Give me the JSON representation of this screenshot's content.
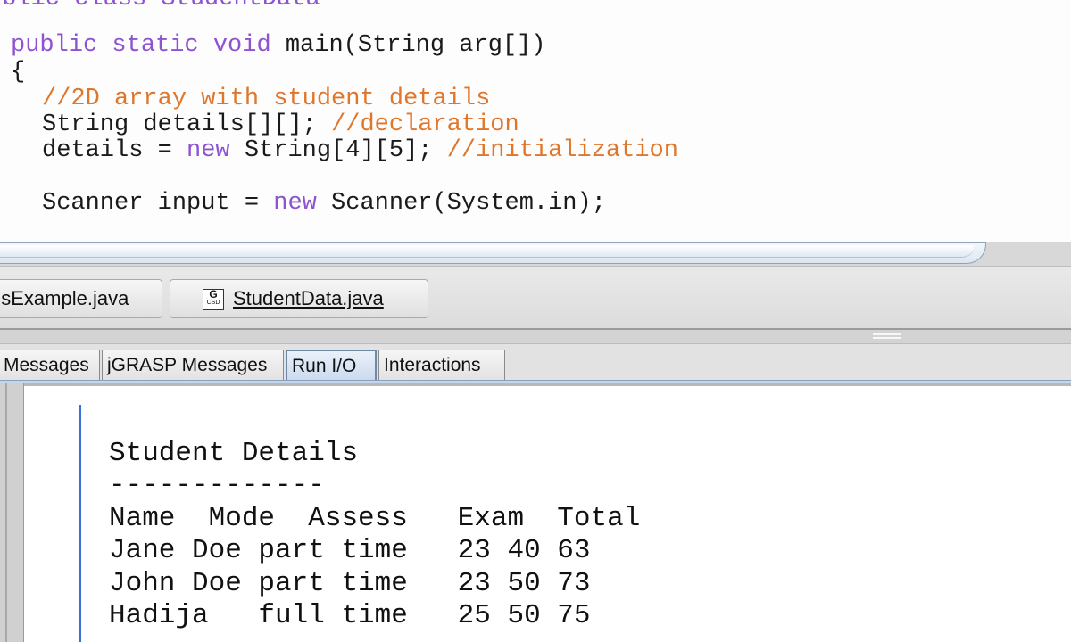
{
  "editor": {
    "header_partial": "ublic class StudentData",
    "main_sig": {
      "kw": "public static void",
      "rest": " main(String arg[])"
    },
    "open_brace": "{",
    "comment_2d": "//2D array with student details",
    "decl": {
      "code": "String details[][]; ",
      "comment": "//declaration"
    },
    "init": {
      "code1": "details = ",
      "kw": "new",
      "code2": " String[4][5]; ",
      "comment": "//initialization"
    },
    "scanner": {
      "code1": "Scanner input = ",
      "kw": "new",
      "code2": " Scanner(System.in);"
    }
  },
  "file_tabs": [
    {
      "label": "nsExample.java",
      "active": false
    },
    {
      "label": "StudentData.java",
      "active": true,
      "icon": "jgrasp-csd-file-icon",
      "icon_text": "G",
      "icon_sub": "CSD"
    }
  ],
  "message_tabs": [
    {
      "label": "Messages",
      "active": false
    },
    {
      "label": "jGRASP Messages",
      "active": false
    },
    {
      "label": "Run I/O",
      "active": true
    },
    {
      "label": "Interactions",
      "active": false
    }
  ],
  "run_output": {
    "lines": [
      "Student Details",
      "-------------",
      "Name  Mode  Assess   Exam  Total",
      "Jane Doe part time   23 40 63",
      "John Doe part time   23 50 73",
      "Hadija   full time   25 50 75"
    ]
  },
  "colors": {
    "keyword": "#8d53d1",
    "comment": "#e0762b",
    "active_tab": "#c9d9ee",
    "run_marker": "#3a6fd8"
  }
}
